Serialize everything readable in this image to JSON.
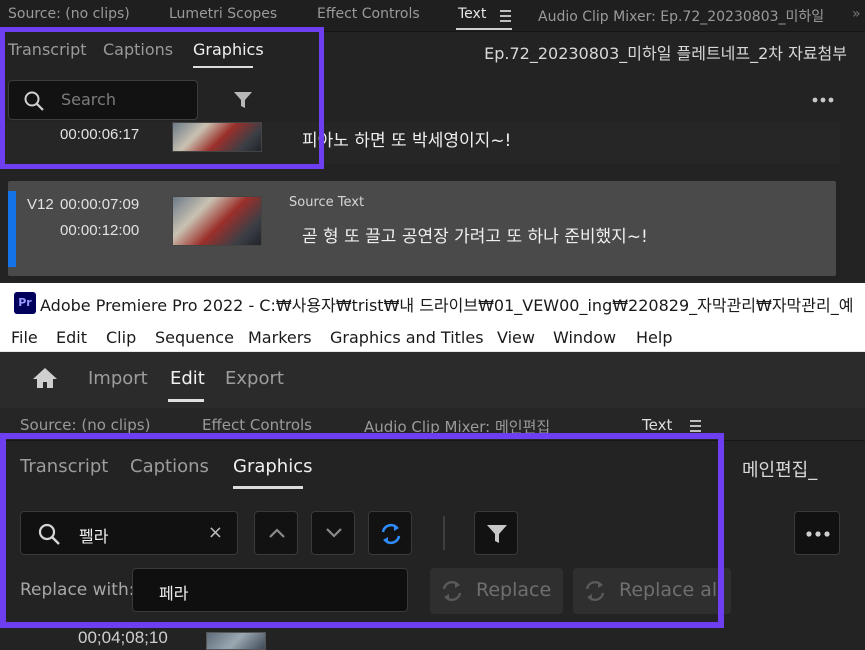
{
  "top_panel": {
    "tabs": [
      "Source: (no clips)",
      "Lumetri Scopes",
      "Effect Controls",
      "Text",
      "Audio Clip Mixer: Ep.72_20230803_미하일"
    ],
    "subtabs": [
      "Transcript",
      "Captions",
      "Graphics"
    ],
    "active_subtab": "Graphics",
    "sequence_name": "Ep.72_20230803_미하일 플레트네프_2차 자료첨부",
    "search_placeholder": "Search",
    "rows": [
      {
        "track": "",
        "in": "",
        "out": "00:00:06:17",
        "text": "피아노 하면 또 박세영이지~!"
      },
      {
        "track": "V12",
        "in": "00:00:07:09",
        "out": "00:00:12:00",
        "label": "Source Text",
        "text": "곧 형 또 끌고 공연장 가려고 또 하나 준비했지~!"
      }
    ]
  },
  "window": {
    "logo": "Pr",
    "title": "Adobe Premiere Pro 2022 - C:₩사용자₩trist₩내 드라이브₩01_VEW00_ing₩220829_자막관리₩자막관리_예",
    "menu": [
      "File",
      "Edit",
      "Clip",
      "Sequence",
      "Markers",
      "Graphics and Titles",
      "View",
      "Window",
      "Help"
    ],
    "header_tabs": [
      "Import",
      "Edit",
      "Export"
    ],
    "active_header_tab": "Edit"
  },
  "bottom_panel": {
    "tabs": [
      "Source: (no clips)",
      "Effect Controls",
      "Audio Clip Mixer: 메인편집_",
      "Text"
    ],
    "subtabs": [
      "Transcript",
      "Captions",
      "Graphics"
    ],
    "active_subtab": "Graphics",
    "sequence_name": "메인편집_",
    "find_value": "펠라",
    "clear_symbol": "×",
    "replace_label": "Replace with:",
    "replace_value": "페라",
    "replace_button": "Replace",
    "replace_all_button": "Replace all",
    "partial_timecode": "00;04;08;10"
  },
  "colors": {
    "highlight": "#6e3ff0",
    "selection_accent": "#1473e6"
  }
}
